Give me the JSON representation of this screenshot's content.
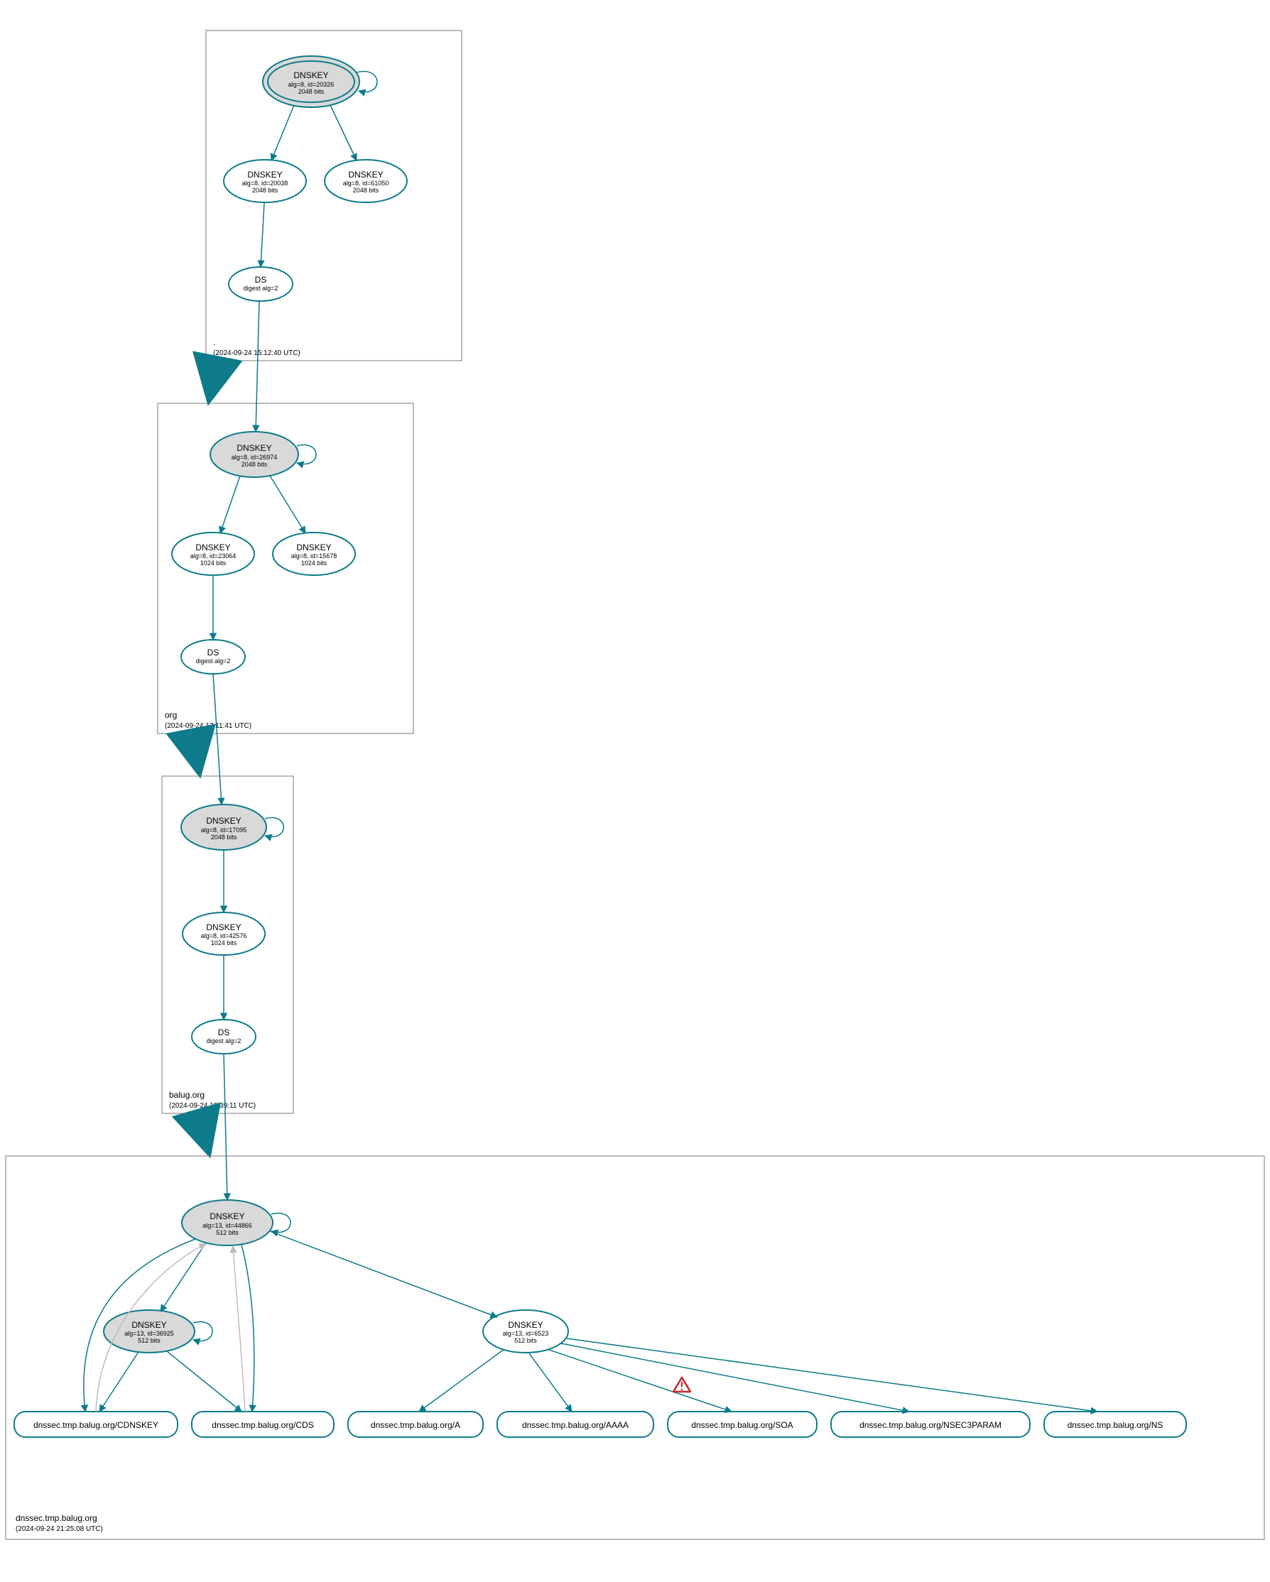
{
  "zones": {
    "root": {
      "name": ".",
      "timestamp": "(2024-09-24 15:12:40 UTC)"
    },
    "org": {
      "name": "org",
      "timestamp": "(2024-09-24 17:11:41 UTC)"
    },
    "balug": {
      "name": "balug.org",
      "timestamp": "(2024-09-24 18:39:11 UTC)"
    },
    "dnssec": {
      "name": "dnssec.tmp.balug.org",
      "timestamp": "(2024-09-24 21:25:08 UTC)"
    }
  },
  "nodes": {
    "root_ksk": {
      "title": "DNSKEY",
      "sub1": "alg=8, id=20326",
      "sub2": "2048 bits"
    },
    "root_zsk1": {
      "title": "DNSKEY",
      "sub1": "alg=8, id=20038",
      "sub2": "2048 bits"
    },
    "root_zsk2": {
      "title": "DNSKEY",
      "sub1": "alg=8, id=61050",
      "sub2": "2048 bits"
    },
    "root_ds": {
      "title": "DS",
      "sub1": "digest alg=2"
    },
    "org_ksk": {
      "title": "DNSKEY",
      "sub1": "alg=8, id=26974",
      "sub2": "2048 bits"
    },
    "org_zsk1": {
      "title": "DNSKEY",
      "sub1": "alg=8, id=23064",
      "sub2": "1024 bits"
    },
    "org_zsk2": {
      "title": "DNSKEY",
      "sub1": "alg=8, id=15678",
      "sub2": "1024 bits"
    },
    "org_ds": {
      "title": "DS",
      "sub1": "digest alg=2"
    },
    "balug_ksk": {
      "title": "DNSKEY",
      "sub1": "alg=8, id=17095",
      "sub2": "2048 bits"
    },
    "balug_zsk": {
      "title": "DNSKEY",
      "sub1": "alg=8, id=42576",
      "sub2": "1024 bits"
    },
    "balug_ds": {
      "title": "DS",
      "sub1": "digest alg=2"
    },
    "dnssec_ksk": {
      "title": "DNSKEY",
      "sub1": "alg=13, id=44866",
      "sub2": "512 bits"
    },
    "dnssec_zsk1": {
      "title": "DNSKEY",
      "sub1": "alg=13, id=36925",
      "sub2": "512 bits"
    },
    "dnssec_zsk2": {
      "title": "DNSKEY",
      "sub1": "alg=13, id=6523",
      "sub2": "512 bits"
    }
  },
  "rrsets": {
    "cdnskey": "dnssec.tmp.balug.org/CDNSKEY",
    "cds": "dnssec.tmp.balug.org/CDS",
    "a": "dnssec.tmp.balug.org/A",
    "aaaa": "dnssec.tmp.balug.org/AAAA",
    "soa": "dnssec.tmp.balug.org/SOA",
    "nsec3p": "dnssec.tmp.balug.org/NSEC3PARAM",
    "ns": "dnssec.tmp.balug.org/NS"
  },
  "warning_icon": "warning-triangle"
}
